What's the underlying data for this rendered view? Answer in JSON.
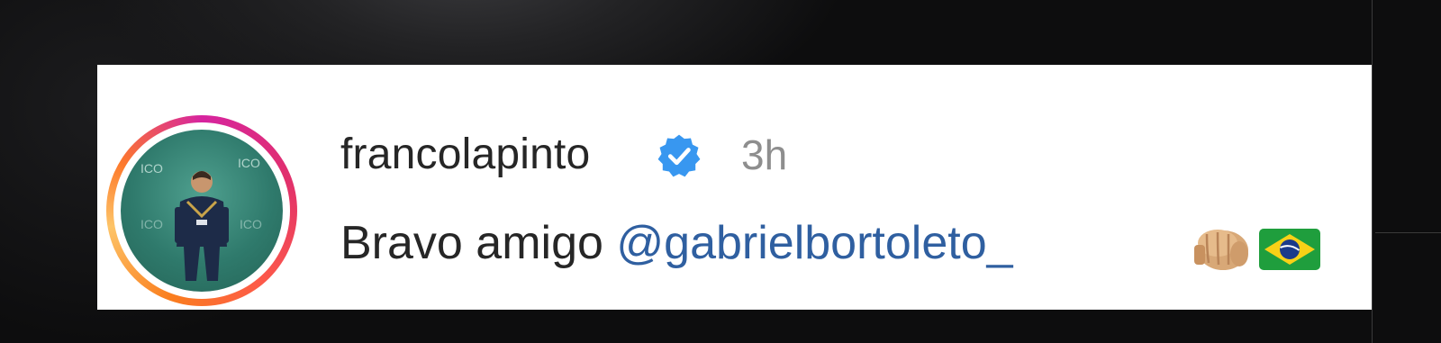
{
  "comment": {
    "username": "francolapinto",
    "verified": true,
    "timestamp": "3h",
    "text": "Bravo amigo ",
    "mention": "@gabrielbortoleto_",
    "emojis": [
      "oncoming-fist-emoji",
      "brazil-flag-emoji"
    ]
  },
  "colors": {
    "card_background": "#ffffff",
    "username": "#262626",
    "timestamp": "#8e8e8e",
    "mention": "#2f5fa0",
    "verified_badge": "#3897f0",
    "page_background": "#0d0d0e"
  },
  "icons": {
    "verified": "verified-badge-icon",
    "avatar": "profile-photo"
  }
}
